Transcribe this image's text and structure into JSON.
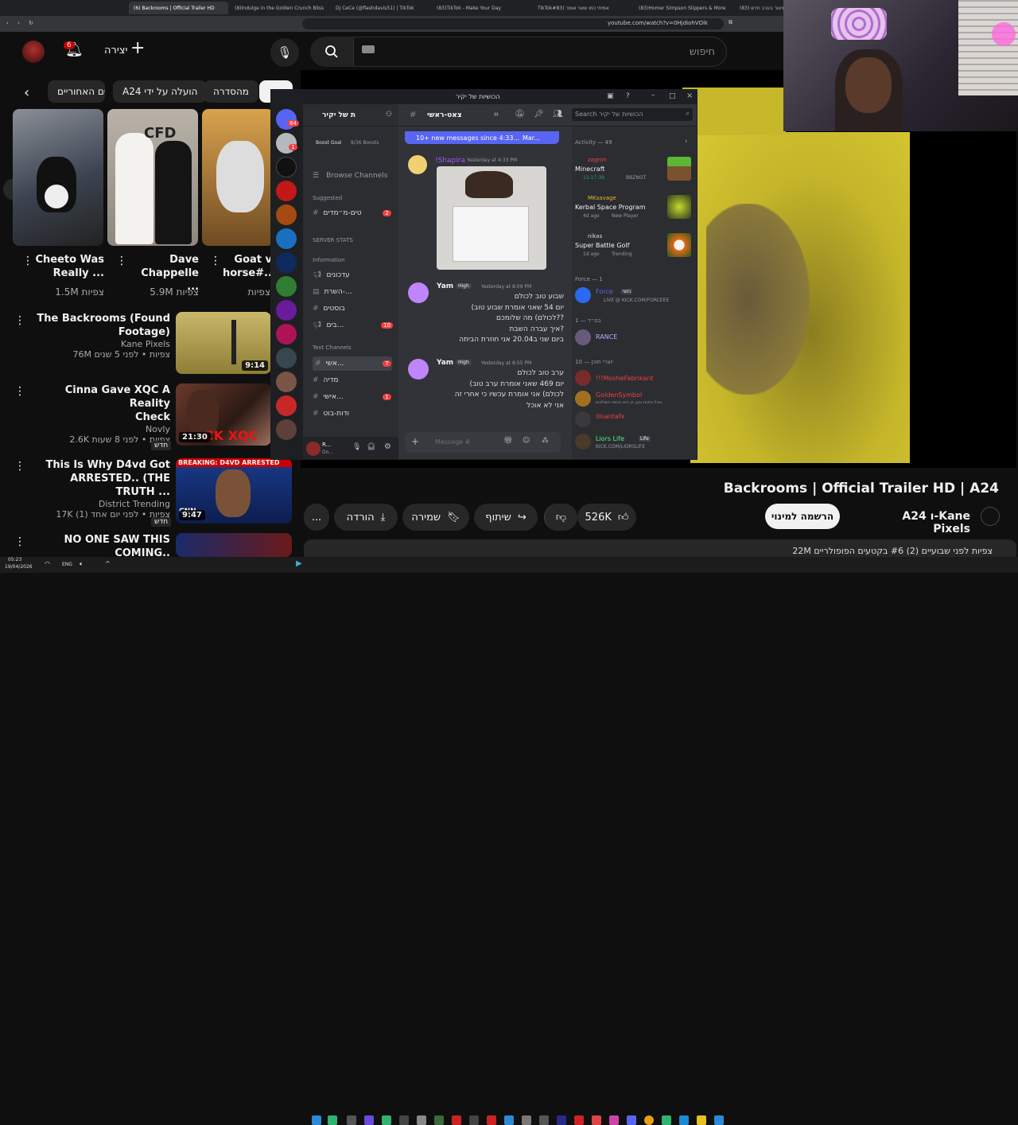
{
  "browser": {
    "tabs": [
      {
        "label": "",
        "active": false
      },
      {
        "label": "(6) Backrooms | Official Trailer HD",
        "active": true
      },
      {
        "label": "(8)Indulge in the Golden Crunch Bliss",
        "active": false
      },
      {
        "label": "Dj CeCe (@flashdavis51) | TikTok",
        "active": false
      },
      {
        "label": "(83)TikTok - Make Your Day",
        "active": false
      },
      {
        "label": "TikTok#83) אמיתי כמו שאני אומר",
        "active": false
      },
      {
        "label": "(83)Homer Simpson Slippers & More",
        "active": false
      },
      {
        "label": "(83) שיעור בערב חדש ...",
        "active": false
      }
    ],
    "url": "youtube.com/watch?v=0HjdiohVOik"
  },
  "youtube": {
    "header": {
      "notif_count": "6",
      "create_label": "יצירה",
      "search_placeholder": "חיפוש"
    },
    "chips": [
      "החדרים האחוריים",
      "A24 הועלה על ידי",
      "מהסדרה",
      ""
    ],
    "shorts": [
      {
        "title": "Cheeto Was Really",
        "line1": "Cheeto Was",
        "line2": "Really ...",
        "views": "1.5M צפיות"
      },
      {
        "title": "Dave Chappelle",
        "line1": "Dave",
        "line2": "Chappelle ...",
        "views": "5.9M צפיות"
      },
      {
        "title": "Goat v horse",
        "line1": "Goat v",
        "line2": "horse#...",
        "views": "צפיות"
      }
    ],
    "recommended": [
      {
        "title1": "The Backrooms (Found",
        "title2": "Footage)",
        "channel": "Kane Pixels",
        "meta": "76M צפיות • לפני 5 שנים",
        "duration": "9:14",
        "badge": ""
      },
      {
        "title1": "Cinna Gave XQC A Reality",
        "title2": "Check",
        "channel": "Novly",
        "meta": "2.6K צפיות • לפני 8 שעות",
        "duration": "21:30",
        "badge": "חדש"
      },
      {
        "title1": "This Is Why D4vd Got",
        "title2": "ARRESTED.. (THE TRUTH ...",
        "channel": "District Trending",
        "meta": "17K צפיות • לפני יום אחד (1)",
        "duration": "9:47",
        "badge": "חדש"
      },
      {
        "title1": "NO ONE SAW THIS COMING..",
        "title2": "",
        "channel": "",
        "meta": "",
        "duration": "",
        "badge": ""
      }
    ],
    "thumb_texts": {
      "cinna_overlay": "CK XQC",
      "breaking": "BREAKING: D4VD ARRESTED",
      "cnn": "CNN"
    },
    "main_video": {
      "title": "Backrooms | Official Trailer HD | A24",
      "channel": "A24 ו-Kane Pixels",
      "subscribe": "הרשמה למינוי",
      "likes": "526K",
      "share": "שיתוף",
      "save": "שמירה",
      "download": "הורדה",
      "more": "...",
      "desc_preview": "22M צפיות לפני שבועיים (2) #6 בקטעים הפופולריים"
    }
  },
  "discord": {
    "window_title": "הכושיות של יקיר",
    "server_name": "ת של יקיר",
    "channel_name": "צאט-ראשי",
    "search_placeholder": "Search הכושיות של יקיר",
    "boost_goal": "Boost Goal",
    "boost_count": "8/36 Boosts",
    "browse_channels": "Browse Channels",
    "suggested": "Suggested",
    "suggested_channel": {
      "name": "טים-מ״מדים",
      "count": "2"
    },
    "server_stats": "SERVER STATS",
    "information": "Information",
    "info_channels": [
      "עדכונים",
      "השרת-...",
      "בוסטים",
      "בים..."
    ],
    "info_badges": [
      "",
      "",
      "",
      "10"
    ],
    "text_channels_label": "Text Channels",
    "text_channels": [
      {
        "name": "אשי...",
        "badge": "7"
      },
      {
        "name": "מדיה",
        "badge": ""
      },
      {
        "name": "אישי...",
        "badge": "1"
      },
      {
        "name": "ודות-בוט",
        "badge": ""
      }
    ],
    "new_messages": "10+ new messages since 4:33...",
    "mark_read": "Mar...",
    "messages": [
      {
        "author": "!Shapira",
        "time": "Yesterday at 4:33 PM",
        "tag": "",
        "lines": []
      },
      {
        "author": "Yam",
        "tag": "High",
        "time": "Yesterday at 8:09 PM",
        "lines": [
          "שבוע טוב לכולם",
          "(יום 54 שאני אומרת שבוע טוב",
          "לכולם) מה שלומכם??",
          "איך עברה השבת?",
          "ביום שני ב20.04 אני חוזרת הביתה"
        ]
      },
      {
        "author": "Yam",
        "tag": "High",
        "time": "Yesterday at 8:55 PM",
        "lines": [
          "ערב טוב לכולם",
          "(יום 469 שאני אומרת ערב טוב",
          "לכולם) אני אומרת עכשיו כי אחרי זה",
          "אני לא אוכל"
        ]
      }
    ],
    "message_placeholder": "Message #",
    "user_name": "R...",
    "user_status": "Do...",
    "server_badges": {
      "top": "64",
      "second": "1"
    },
    "activity_title": "Activity — 49",
    "activities": [
      {
        "user": "zagron",
        "game": "Minecraft",
        "detail": "11:17:39",
        "extra": "BBZNOT",
        "color": "#f23f43"
      },
      {
        "user": "MKsavage",
        "game": "Kerbal Space Program",
        "detail": "4d ago",
        "extra": "New Player",
        "color": "#f0b232"
      },
      {
        "user": "nikas",
        "game": "Super Battle Golf",
        "detail": "1d ago",
        "extra": "Trending",
        "color": "#dbdee1"
      }
    ],
    "force_header": "Force — 1",
    "force_member": {
      "name": "Force",
      "tag": "כושי",
      "status": "LIVE @ KICK.COM/FORCEEE"
    },
    "group2_header": "בס״ד — 1",
    "group2_member": "RANCE",
    "group3_header": "יוצרי תוכן — 10",
    "members": [
      {
        "name": "!!!MosheFabrikant",
        "sub": "",
        "color": "#f23f43"
      },
      {
        "name": "GoldenSymbol",
        "sub": "אוכל בחוות גבון, כן הוא הכושי השולטים",
        "color": "#f23f43"
      },
      {
        "name": "lilsantafx",
        "sub": "",
        "color": "#f23f43"
      },
      {
        "name": "Liors Life",
        "sub": "KICK.COM/LIORSLIFE",
        "tag": "Life",
        "color": "#57f287"
      }
    ]
  },
  "taskbar": {
    "time": "05:23",
    "date": "19/04/2026",
    "lang": "ENG"
  }
}
